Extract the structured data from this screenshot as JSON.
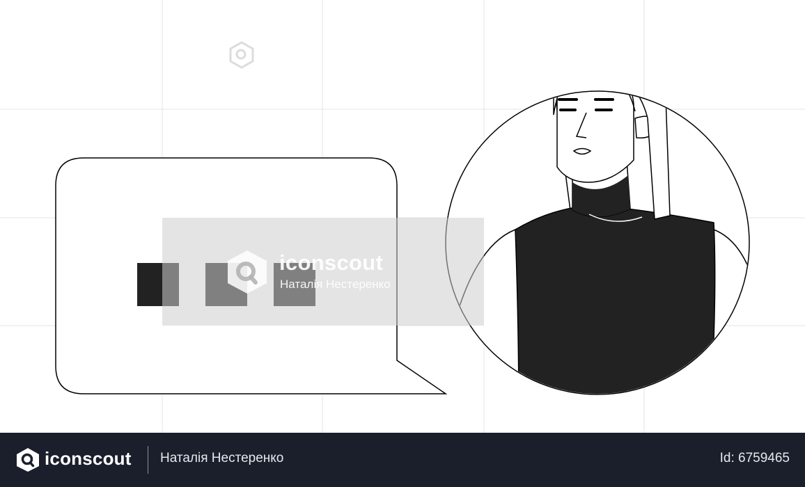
{
  "watermark": {
    "brand": "iconscout",
    "author": "Наталія Нестеренко"
  },
  "footer": {
    "brand": "iconscout",
    "author": "Наталія Нестеренко",
    "asset_id": "Id: 6759465"
  },
  "colors": {
    "footer_bg": "#1b1f2b",
    "ink": "#000000",
    "dark_fill": "#222222"
  },
  "icons": [
    "iconscout-logo-icon",
    "speech-bubble-icon",
    "typing-dots-icon",
    "woman-avatar-illustration"
  ]
}
